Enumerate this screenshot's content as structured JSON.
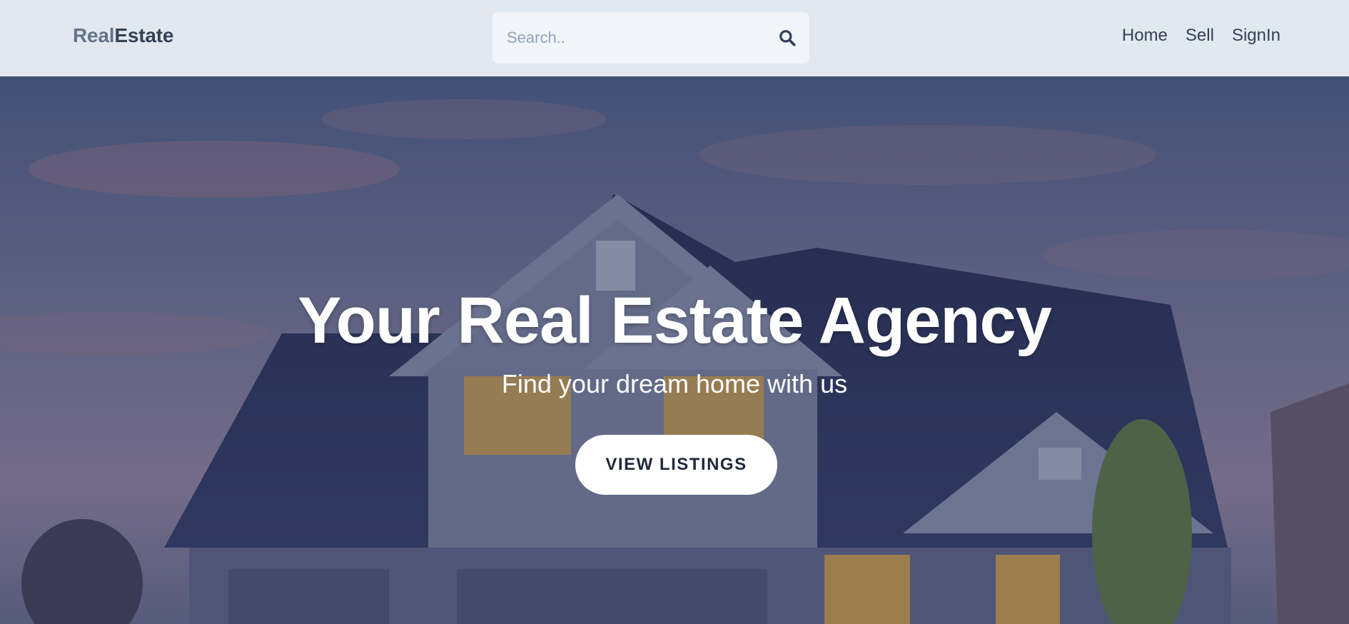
{
  "header": {
    "logo_part1": "Real",
    "logo_part2": "Estate",
    "search": {
      "placeholder": "Search..",
      "value": ""
    },
    "nav": [
      {
        "label": "Home"
      },
      {
        "label": "Sell"
      },
      {
        "label": "SignIn"
      }
    ]
  },
  "hero": {
    "title": "Your Real Estate Agency",
    "subtitle": "Find your dream home with us",
    "cta_label": "VIEW LISTINGS"
  },
  "colors": {
    "header_bg": "#e2e8f0",
    "search_bg": "#f1f5f9",
    "text_dark": "#334155",
    "logo_light": "#64748b",
    "cta_bg": "#ffffff"
  },
  "icons": {
    "search": "search-icon"
  }
}
